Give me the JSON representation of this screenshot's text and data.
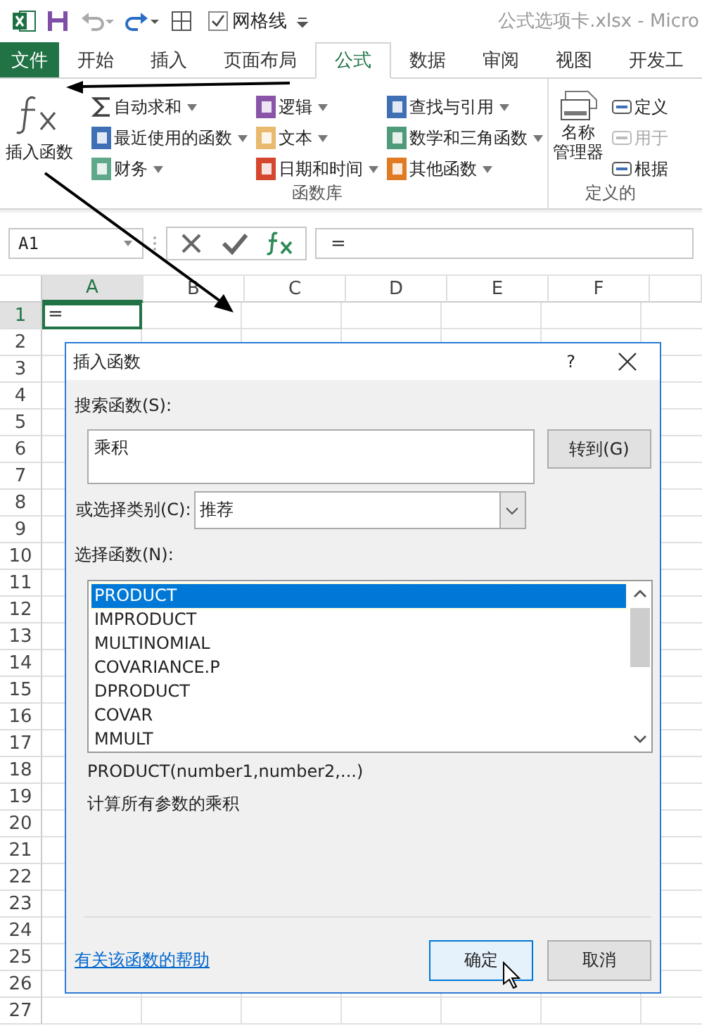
{
  "quick_access": {
    "gridlines": {
      "label": "网格线",
      "checked": true
    }
  },
  "window": {
    "title": "公式选项卡.xlsx - Micro"
  },
  "tabs": [
    {
      "label": "文件",
      "kind": "file",
      "selected": false
    },
    {
      "label": "开始",
      "kind": "tab",
      "selected": false
    },
    {
      "label": "插入",
      "kind": "tab",
      "selected": false
    },
    {
      "label": "页面布局",
      "kind": "tab",
      "selected": false
    },
    {
      "label": "公式",
      "kind": "tab",
      "selected": true
    },
    {
      "label": "数据",
      "kind": "tab",
      "selected": false
    },
    {
      "label": "审阅",
      "kind": "tab",
      "selected": false
    },
    {
      "label": "视图",
      "kind": "tab",
      "selected": false
    },
    {
      "label": "开发工",
      "kind": "tab",
      "selected": false
    }
  ],
  "ribbon": {
    "insert_function": {
      "label": "插入函数"
    },
    "function_library": {
      "label": "函数库",
      "columns": [
        [
          {
            "label": "自动求和",
            "kind": "sum",
            "color": "#404040"
          },
          {
            "label": "最近使用的函数",
            "kind": "book",
            "color": "#3f6fb5"
          },
          {
            "label": "财务",
            "kind": "book",
            "color": "#5fa98a"
          }
        ],
        [
          {
            "label": "逻辑",
            "kind": "book",
            "color": "#8a55a8"
          },
          {
            "label": "文本",
            "kind": "book",
            "color": "#e9b96e"
          },
          {
            "label": "日期和时间",
            "kind": "book",
            "color": "#d4472e"
          }
        ],
        [
          {
            "label": "查找与引用",
            "kind": "book",
            "color": "#3f6fb5"
          },
          {
            "label": "数学和三角函数",
            "kind": "book",
            "color": "#4f9a78"
          },
          {
            "label": "其他函数",
            "kind": "book",
            "color": "#e07b24"
          }
        ]
      ]
    },
    "defined_names": {
      "label": "定义的",
      "manager": [
        "名称",
        "管理器"
      ],
      "items": [
        {
          "label": "定义",
          "disabled": false
        },
        {
          "label": "用于",
          "disabled": true
        },
        {
          "label": "根据",
          "disabled": false
        }
      ]
    }
  },
  "formula_bar": {
    "name_box": "A1",
    "formula": "="
  },
  "sheet": {
    "columns": [
      {
        "label": "A",
        "selected": true
      },
      {
        "label": "B",
        "selected": false
      },
      {
        "label": "C",
        "selected": false
      },
      {
        "label": "D",
        "selected": false
      },
      {
        "label": "E",
        "selected": false
      },
      {
        "label": "F",
        "selected": false
      }
    ],
    "rows": [
      {
        "label": "1",
        "selected": true,
        "value": "="
      },
      {
        "label": "2",
        "selected": false
      },
      {
        "label": "3",
        "selected": false
      },
      {
        "label": "4",
        "selected": false
      },
      {
        "label": "5",
        "selected": false
      },
      {
        "label": "6",
        "selected": false
      },
      {
        "label": "7",
        "selected": false
      },
      {
        "label": "8",
        "selected": false
      },
      {
        "label": "9",
        "selected": false
      },
      {
        "label": "10",
        "selected": false
      },
      {
        "label": "11",
        "selected": false
      },
      {
        "label": "12",
        "selected": false
      },
      {
        "label": "13",
        "selected": false
      },
      {
        "label": "14",
        "selected": false
      },
      {
        "label": "15",
        "selected": false
      },
      {
        "label": "16",
        "selected": false
      },
      {
        "label": "17",
        "selected": false
      },
      {
        "label": "18",
        "selected": false
      },
      {
        "label": "19",
        "selected": false
      },
      {
        "label": "20",
        "selected": false
      },
      {
        "label": "21",
        "selected": false
      },
      {
        "label": "22",
        "selected": false
      },
      {
        "label": "23",
        "selected": false
      },
      {
        "label": "24",
        "selected": false
      },
      {
        "label": "25",
        "selected": false
      },
      {
        "label": "26",
        "selected": false
      },
      {
        "label": "27",
        "selected": false
      }
    ]
  },
  "dialog": {
    "title": "插入函数",
    "help": "?",
    "search_label": "搜索函数(S):",
    "search_value": "乘积",
    "goto_button": "转到(G)",
    "category_label": "或选择类别(C):",
    "category_value": "推荐",
    "list_label": "选择函数(N):",
    "functions": [
      {
        "name": "PRODUCT",
        "selected": true
      },
      {
        "name": "IMPRODUCT",
        "selected": false
      },
      {
        "name": "MULTINOMIAL",
        "selected": false
      },
      {
        "name": "COVARIANCE.P",
        "selected": false
      },
      {
        "name": "DPRODUCT",
        "selected": false
      },
      {
        "name": "COVAR",
        "selected": false
      },
      {
        "name": "MMULT",
        "selected": false
      }
    ],
    "signature": "PRODUCT(number1,number2,...)",
    "description": "计算所有参数的乘积",
    "help_link": "有关该函数的帮助",
    "buttons": [
      {
        "label": "确定",
        "default": true
      },
      {
        "label": "取消",
        "default": false
      }
    ]
  }
}
